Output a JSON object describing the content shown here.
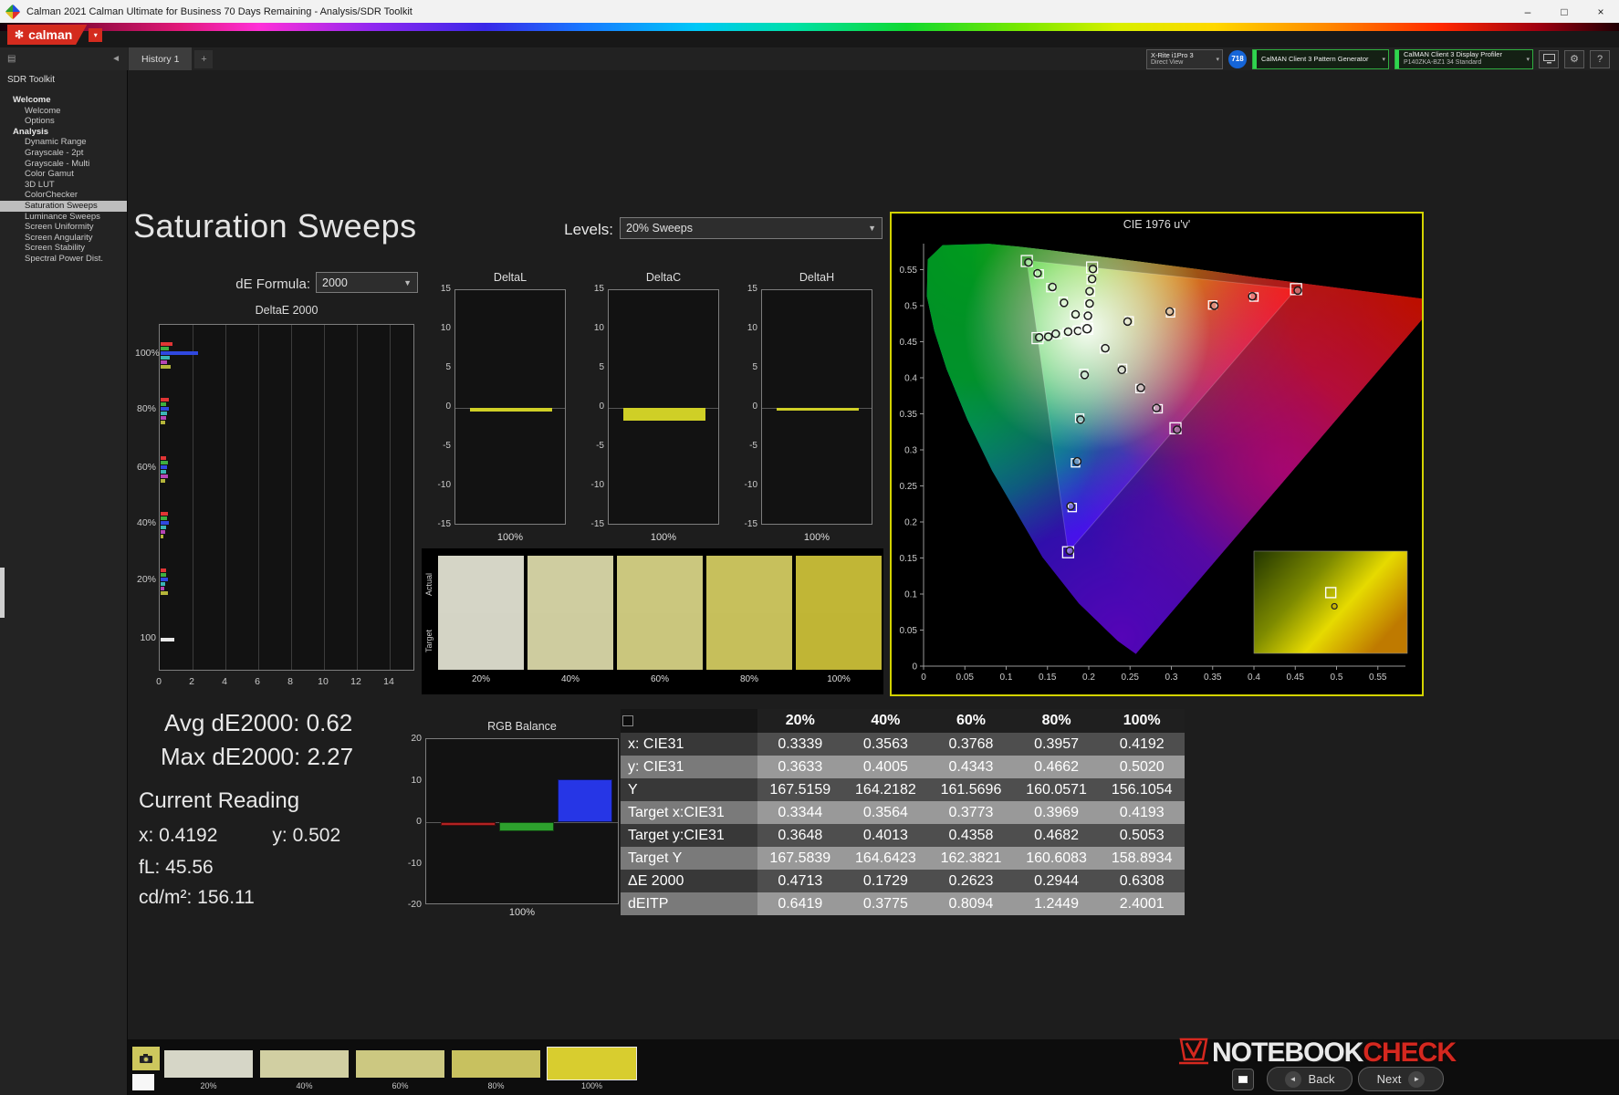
{
  "window": {
    "title": "Calman 2021 Calman Ultimate for Business 70 Days Remaining  - Analysis/SDR Toolkit",
    "minimize": "–",
    "maximize": "□",
    "close": "×"
  },
  "brand": {
    "logo": "calman",
    "dropdown": "▾"
  },
  "topbar": {
    "meter": {
      "line1": "X-Rite i1Pro 3",
      "line2": "Direct View"
    },
    "badge": "718",
    "pattern_generator": "CalMAN Client 3 Pattern Generator",
    "profiler_line1": "CalMAN Client 3 Display Profiler",
    "profiler_line2": "P140ZKA-BZ1 34 Standard"
  },
  "tabs": {
    "history": "History 1",
    "add": "+"
  },
  "sidebar": {
    "title": "SDR Toolkit",
    "sections": [
      {
        "label": "Welcome",
        "items": [
          {
            "label": "Welcome"
          },
          {
            "label": "Options"
          }
        ]
      },
      {
        "label": "Analysis",
        "items": [
          {
            "label": "Dynamic Range"
          },
          {
            "label": "Grayscale - 2pt"
          },
          {
            "label": "Grayscale - Multi"
          },
          {
            "label": "Color Gamut"
          },
          {
            "label": "3D LUT"
          },
          {
            "label": "ColorChecker"
          },
          {
            "label": "Saturation Sweeps",
            "selected": true
          },
          {
            "label": "Luminance Sweeps"
          },
          {
            "label": "Screen Uniformity"
          },
          {
            "label": "Screen Angularity"
          },
          {
            "label": "Screen Stability"
          },
          {
            "label": "Spectral Power Dist."
          }
        ]
      }
    ]
  },
  "page": {
    "title": "Saturation Sweeps",
    "levels_label": "Levels:",
    "levels_value": "20% Sweeps",
    "de_label": "dE Formula:",
    "de_value": "2000"
  },
  "readings": {
    "avg": "Avg dE2000: 0.62",
    "max": "Max dE2000: 2.27",
    "current": "Current Reading",
    "x": "x: 0.4192",
    "y": "y: 0.502",
    "fl": "fL: 45.56",
    "cd": "cd/m²: 156.11"
  },
  "swatches": {
    "row_labels": [
      "Actual",
      "Target"
    ],
    "levels": [
      "20%",
      "40%",
      "60%",
      "80%",
      "100%"
    ],
    "actual": [
      "#d5d5c6",
      "#cfcda0",
      "#cbc77e",
      "#c7c05c",
      "#c1b636"
    ],
    "target": [
      "#d4d4c5",
      "#cecc9f",
      "#cac67d",
      "#c6bf5b",
      "#c0b535"
    ]
  },
  "table": {
    "columns": [
      "20%",
      "40%",
      "60%",
      "80%",
      "100%"
    ],
    "rows": [
      {
        "label": "x: CIE31",
        "values": [
          "0.3339",
          "0.3563",
          "0.3768",
          "0.3957",
          "0.4192"
        ]
      },
      {
        "label": "y: CIE31",
        "values": [
          "0.3633",
          "0.4005",
          "0.4343",
          "0.4662",
          "0.5020"
        ]
      },
      {
        "label": "Y",
        "values": [
          "167.5159",
          "164.2182",
          "161.5696",
          "160.0571",
          "156.1054"
        ]
      },
      {
        "label": "Target x:CIE31",
        "values": [
          "0.3344",
          "0.3564",
          "0.3773",
          "0.3969",
          "0.4193"
        ]
      },
      {
        "label": "Target y:CIE31",
        "values": [
          "0.3648",
          "0.4013",
          "0.4358",
          "0.4682",
          "0.5053"
        ]
      },
      {
        "label": "Target Y",
        "values": [
          "167.5839",
          "164.6423",
          "162.3821",
          "160.6083",
          "158.8934"
        ]
      },
      {
        "label": "ΔE 2000",
        "values": [
          "0.4713",
          "0.1729",
          "0.2623",
          "0.2944",
          "0.6308"
        ]
      },
      {
        "label": "dEITP",
        "values": [
          "0.6419",
          "0.3775",
          "0.8094",
          "1.2449",
          "2.4001"
        ]
      }
    ]
  },
  "bottom": {
    "thumbnails": [
      {
        "label": "20%",
        "color": "#d6d6c7"
      },
      {
        "label": "40%",
        "color": "#d1cfa2"
      },
      {
        "label": "60%",
        "color": "#ccc881"
      },
      {
        "label": "80%",
        "color": "#c8c15f"
      },
      {
        "label": "100%",
        "color": "#d8cd2f",
        "selected": true
      }
    ],
    "back": "Back",
    "next": "Next"
  },
  "watermark": {
    "part1": "NOTEBOOK",
    "part2": "CHECK"
  },
  "chart_data": [
    {
      "id": "deltae2000",
      "type": "bar",
      "orientation": "horizontal",
      "title": "DeltaE 2000",
      "xlim": [
        0,
        14
      ],
      "xticks": [
        0,
        2,
        4,
        6,
        8,
        10,
        12,
        14
      ],
      "series_colors": {
        "red": "#e03535",
        "green": "#3fae3f",
        "blue": "#2f48e0",
        "cyan": "#3ab5b5",
        "magenta": "#b545b5",
        "yellow": "#b5b53a",
        "white": "#e8e8e8"
      },
      "groups": [
        {
          "label": "100%",
          "colors": [
            "red",
            "green",
            "blue",
            "cyan",
            "magenta",
            "yellow"
          ],
          "values": [
            0.71,
            0.52,
            2.27,
            0.55,
            0.38,
            0.63
          ]
        },
        {
          "label": "80%",
          "colors": [
            "red",
            "green",
            "blue",
            "cyan",
            "magenta",
            "yellow"
          ],
          "values": [
            0.48,
            0.36,
            0.52,
            0.41,
            0.33,
            0.29
          ]
        },
        {
          "label": "60%",
          "colors": [
            "red",
            "green",
            "blue",
            "cyan",
            "magenta",
            "yellow"
          ],
          "values": [
            0.33,
            0.47,
            0.38,
            0.31,
            0.42,
            0.26
          ]
        },
        {
          "label": "40%",
          "colors": [
            "red",
            "green",
            "blue",
            "cyan",
            "magenta",
            "yellow"
          ],
          "values": [
            0.45,
            0.39,
            0.52,
            0.36,
            0.28,
            0.17
          ]
        },
        {
          "label": "20%",
          "colors": [
            "red",
            "green",
            "blue",
            "cyan",
            "magenta",
            "yellow"
          ],
          "values": [
            0.31,
            0.36,
            0.42,
            0.29,
            0.24,
            0.47
          ]
        },
        {
          "label": "100",
          "colors": [
            "white"
          ],
          "values": [
            0.82
          ]
        }
      ]
    },
    {
      "id": "deltaL",
      "type": "bar",
      "title": "DeltaL",
      "ylim": [
        -15,
        15
      ],
      "yticks": [
        15,
        10,
        5,
        0,
        -5,
        -10,
        -15
      ],
      "value": -0.5,
      "bar_color": "#cfcf26",
      "xlabel": "100%"
    },
    {
      "id": "deltaC",
      "type": "bar",
      "title": "DeltaC",
      "ylim": [
        -15,
        15
      ],
      "yticks": [
        15,
        10,
        5,
        0,
        -5,
        -10,
        -15
      ],
      "value": -1.6,
      "bar_color": "#cfcf26",
      "xlabel": "100%"
    },
    {
      "id": "deltaH",
      "type": "bar",
      "title": "DeltaH",
      "ylim": [
        -15,
        15
      ],
      "yticks": [
        15,
        10,
        5,
        0,
        -5,
        -10,
        -15
      ],
      "value": -0.3,
      "bar_color": "#cfcf26",
      "xlabel": "100%"
    },
    {
      "id": "rgb",
      "type": "bar",
      "title": "RGB Balance",
      "ylim": [
        -20,
        20
      ],
      "yticks": [
        20,
        10,
        0,
        -10,
        -20
      ],
      "xlabel": "100%",
      "bars": [
        {
          "name": "red",
          "color": "#b22222",
          "value": -0.8
        },
        {
          "name": "green",
          "color": "#2da02d",
          "value": -2.2
        },
        {
          "name": "blue",
          "color": "#2636e6",
          "value": 10.4
        }
      ]
    },
    {
      "id": "cie",
      "type": "scatter",
      "title": "CIE 1976 u'v'",
      "xlim": [
        0,
        0.58
      ],
      "ylim": [
        0,
        0.58
      ],
      "ticks": [
        0,
        0.05,
        0.1,
        0.15,
        0.2,
        0.25,
        0.3,
        0.35,
        0.4,
        0.45,
        0.5,
        0.55
      ],
      "white_point": [
        0.198,
        0.468
      ],
      "gamut_triangle": [
        [
          0.451,
          0.523
        ],
        [
          0.125,
          0.5625
        ],
        [
          0.175,
          0.158
        ]
      ],
      "inset_marker": [
        0.493,
        0.102
      ],
      "sweeps": [
        {
          "name": "red",
          "targets": [
            [
              0.249,
              0.479
            ],
            [
              0.299,
              0.49
            ],
            [
              0.35,
              0.501
            ],
            [
              0.4,
              0.512
            ],
            [
              0.451,
              0.523
            ]
          ],
          "measured": [
            [
              0.247,
              0.478
            ],
            [
              0.298,
              0.492
            ],
            [
              0.352,
              0.5
            ],
            [
              0.398,
              0.513
            ],
            [
              0.453,
              0.521
            ]
          ]
        },
        {
          "name": "green",
          "targets": [
            [
              0.183,
              0.487
            ],
            [
              0.169,
              0.506
            ],
            [
              0.154,
              0.525
            ],
            [
              0.14,
              0.544
            ],
            [
              0.125,
              0.562
            ]
          ],
          "measured": [
            [
              0.184,
              0.488
            ],
            [
              0.17,
              0.504
            ],
            [
              0.156,
              0.526
            ],
            [
              0.138,
              0.545
            ],
            [
              0.127,
              0.56
            ]
          ]
        },
        {
          "name": "blue",
          "targets": [
            [
              0.194,
              0.406
            ],
            [
              0.189,
              0.344
            ],
            [
              0.184,
              0.282
            ],
            [
              0.18,
              0.22
            ],
            [
              0.175,
              0.158
            ]
          ],
          "measured": [
            [
              0.195,
              0.404
            ],
            [
              0.19,
              0.342
            ],
            [
              0.186,
              0.284
            ],
            [
              0.178,
              0.222
            ],
            [
              0.177,
              0.16
            ]
          ]
        },
        {
          "name": "cyan",
          "targets": [
            [
              0.186,
              0.466
            ],
            [
              0.174,
              0.463
            ],
            [
              0.162,
              0.46
            ],
            [
              0.15,
              0.458
            ],
            [
              0.138,
              0.455
            ]
          ],
          "measured": [
            [
              0.187,
              0.465
            ],
            [
              0.175,
              0.464
            ],
            [
              0.16,
              0.461
            ],
            [
              0.151,
              0.457
            ],
            [
              0.14,
              0.456
            ]
          ]
        },
        {
          "name": "magenta",
          "targets": [
            [
              0.219,
              0.44
            ],
            [
              0.241,
              0.413
            ],
            [
              0.262,
              0.385
            ],
            [
              0.284,
              0.357
            ],
            [
              0.305,
              0.33
            ]
          ],
          "measured": [
            [
              0.22,
              0.441
            ],
            [
              0.24,
              0.411
            ],
            [
              0.263,
              0.386
            ],
            [
              0.282,
              0.358
            ],
            [
              0.307,
              0.328
            ]
          ]
        },
        {
          "name": "yellow",
          "targets": [
            [
              0.199,
              0.485
            ],
            [
              0.2,
              0.502
            ],
            [
              0.202,
              0.519
            ],
            [
              0.203,
              0.536
            ],
            [
              0.204,
              0.553
            ]
          ],
          "measured": [
            [
              0.199,
              0.486
            ],
            [
              0.201,
              0.503
            ],
            [
              0.201,
              0.52
            ],
            [
              0.204,
              0.537
            ],
            [
              0.205,
              0.551
            ]
          ]
        }
      ]
    }
  ]
}
